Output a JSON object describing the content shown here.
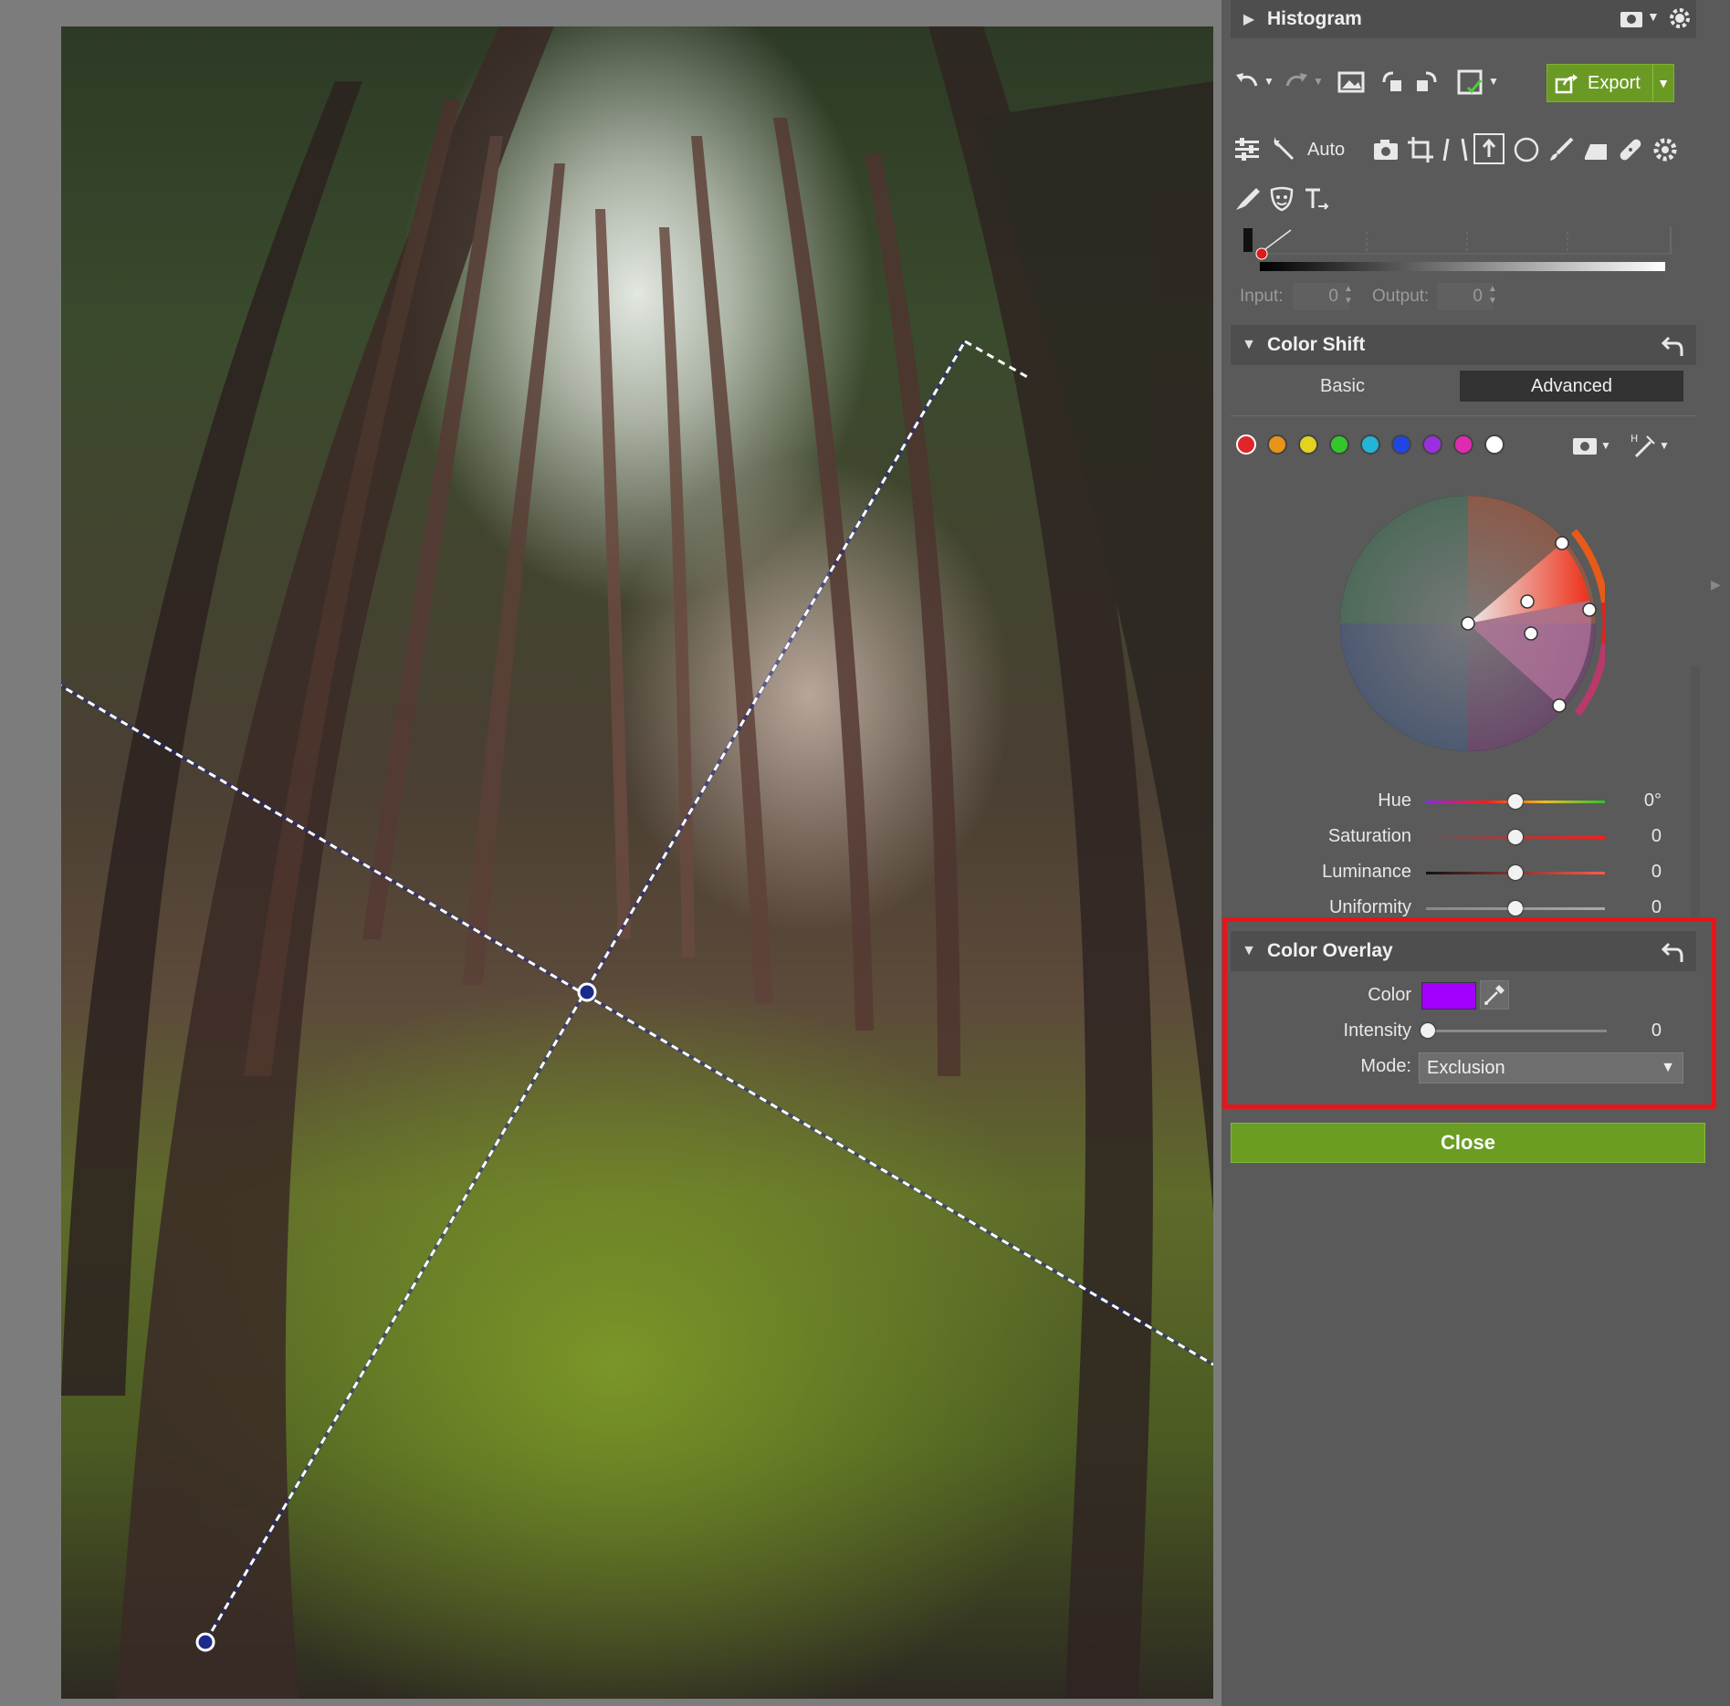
{
  "histogram": {
    "title": "Histogram"
  },
  "toolbar": {
    "export_label": "Export",
    "auto_label": "Auto"
  },
  "curves": {
    "input_label": "Input:",
    "input_value": "0",
    "output_label": "Output:",
    "output_value": "0"
  },
  "color_shift": {
    "title": "Color Shift",
    "tabs": {
      "basic": "Basic",
      "advanced": "Advanced",
      "active": "Advanced"
    },
    "swatches": [
      "#e0262a",
      "#e8941a",
      "#e3d21f",
      "#35c52c",
      "#22b5d6",
      "#1f46e0",
      "#9b2fe0",
      "#e02ab0",
      "#ffffff"
    ],
    "sliders": [
      {
        "label": "Hue",
        "value": "0°",
        "position": 0.5
      },
      {
        "label": "Saturation",
        "value": "0",
        "position": 0.5
      },
      {
        "label": "Luminance",
        "value": "0",
        "position": 0.5
      },
      {
        "label": "Uniformity",
        "value": "0",
        "position": 0.5
      }
    ]
  },
  "color_overlay": {
    "title": "Color Overlay",
    "color_label": "Color",
    "color_value": "#a100ff",
    "intensity_label": "Intensity",
    "intensity_value": "0",
    "intensity_position": 0.0,
    "mode_label": "Mode:",
    "mode_value": "Exclusion"
  },
  "close_label": "Close",
  "colors": {
    "accent_green": "#6a9d22",
    "highlight_red": "#e3161b",
    "panel_bg": "#5a5a5a"
  }
}
